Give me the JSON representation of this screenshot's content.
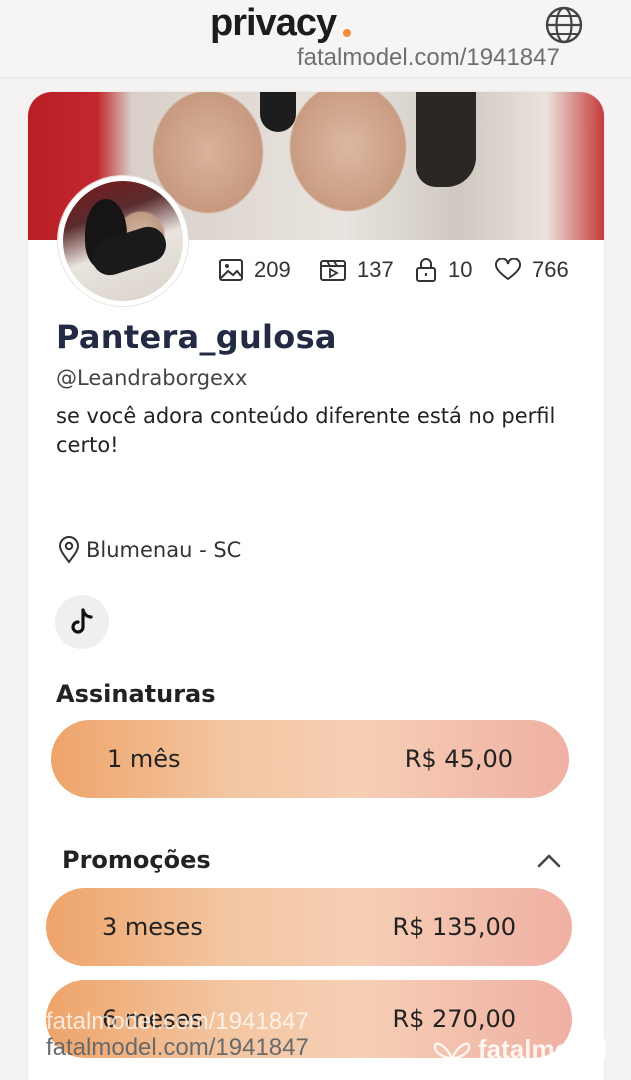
{
  "header": {
    "logo_text": "privacy",
    "globe_icon": "globe-icon",
    "watermark": "fatalmodel.com/1941847"
  },
  "profile": {
    "stats": {
      "photos": "209",
      "videos": "137",
      "locked": "10",
      "likes": "766"
    },
    "name": "Pantera_gulosa",
    "handle": "@Leandraborgexx",
    "bio": "se você adora conteúdo diferente está no perfil certo!",
    "location": "Blumenau - SC",
    "social_icon": "tiktok-icon"
  },
  "subscriptions": {
    "title": "Assinaturas",
    "plans": [
      {
        "period": "1 mês",
        "price": "R$ 45,00"
      }
    ]
  },
  "promotions": {
    "title": "Promoções",
    "plans": [
      {
        "period": "3 meses",
        "price": "R$ 135,00"
      },
      {
        "period": "6 meses",
        "price": "R$ 270,00"
      }
    ]
  },
  "watermarks": {
    "bottom_line1": "fatalmodel.com/1941847",
    "bottom_line2": "fatalmodel.com/1941847",
    "brand": "fatalmodel"
  },
  "colors": {
    "accent_orange": "#f28d3b",
    "name_navy": "#232b44"
  }
}
